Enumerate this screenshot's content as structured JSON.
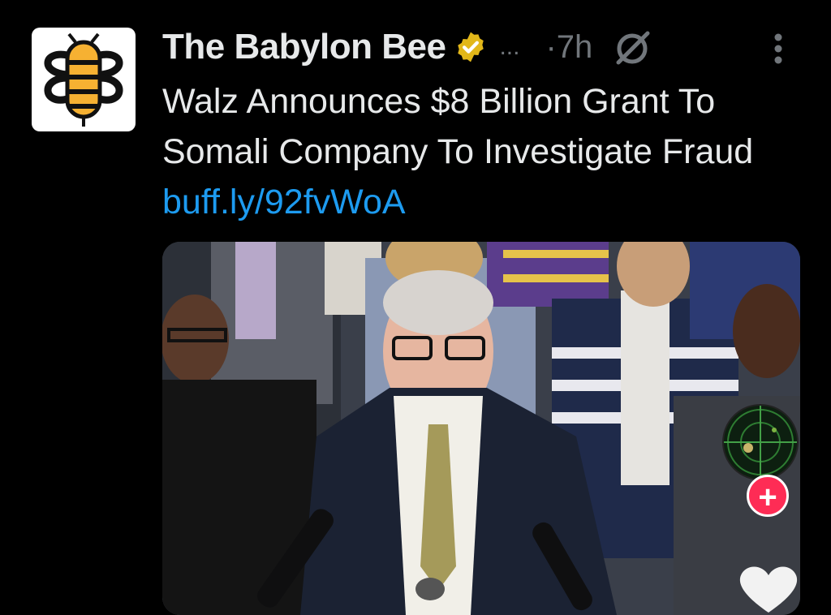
{
  "tweet": {
    "author_name": "The Babylon Bee",
    "more_dots": "...",
    "timestamp": "·7h",
    "text": "Walz Announces $8 Billion Grant To Somali Company To Investigate Fraud",
    "link": "buff.ly/92fvWoA"
  },
  "video_overlay": {
    "add_label": "+"
  },
  "icons": {
    "avatar": "babylon-bee-logo-icon",
    "verified": "verified-badge-icon",
    "grok": "grok-icon",
    "more": "more-vertical-icon",
    "like": "heart-icon"
  },
  "colors": {
    "background": "#000000",
    "text": "#e7e9ea",
    "muted": "#71767b",
    "link": "#1d9bf0",
    "verified_gold": "#e2b719",
    "add_button": "#fe2c55"
  }
}
